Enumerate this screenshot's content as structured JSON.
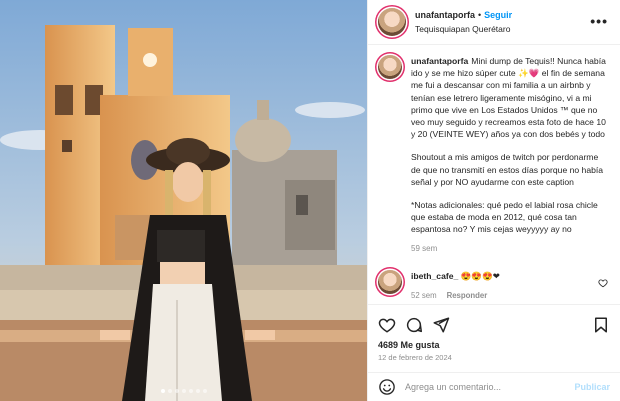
{
  "post": {
    "username": "unafantaporfa",
    "follow_label": "Seguir",
    "separator": "•",
    "location": "Tequisquiapan Querétaro",
    "more_label": "•••"
  },
  "caption": {
    "username": "unafantaporfa",
    "paragraph_1": "Mini dump de Tequis!! Nunca había ido y se me hizo súper cute ✨💗 el fin de semana me fui a descansar con mi familia a un airbnb y tenían ese letrero ligeramente misógino, vi a mi primo que vive en Los Estados Unidos ™ que no veo muy seguido y recreamos esta foto de hace 10 y 20 (VEINTE WEY) años ya con dos bebés y todo",
    "paragraph_2": "Shoutout a mis amigos de twitch por perdonarme de que no transmití en estos días porque no había señal y por NO ayudarme con este caption",
    "paragraph_3": "*Notas adicionales: qué pedo el labial rosa chicle que estaba de moda en 2012, qué cosa tan espantosa no? Y mis cejas weyyyyy ay no",
    "time": "59 sem"
  },
  "comment": {
    "username": "ibeth_cafe_",
    "text": "😍😍😍❤",
    "time": "52 sem",
    "reply_label": "Responder"
  },
  "actions": {
    "likes": "4689 Me gusta",
    "date": "12 de febrero de 2024"
  },
  "add_comment": {
    "placeholder": "Agrega un comentario...",
    "publish_label": "Publicar"
  },
  "carousel": {
    "count": 7,
    "active_index": 0
  },
  "colors": {
    "accent": "#0095f6",
    "text": "#262626",
    "muted": "#8e8e8e",
    "publish_disabled": "#b2dffc"
  }
}
